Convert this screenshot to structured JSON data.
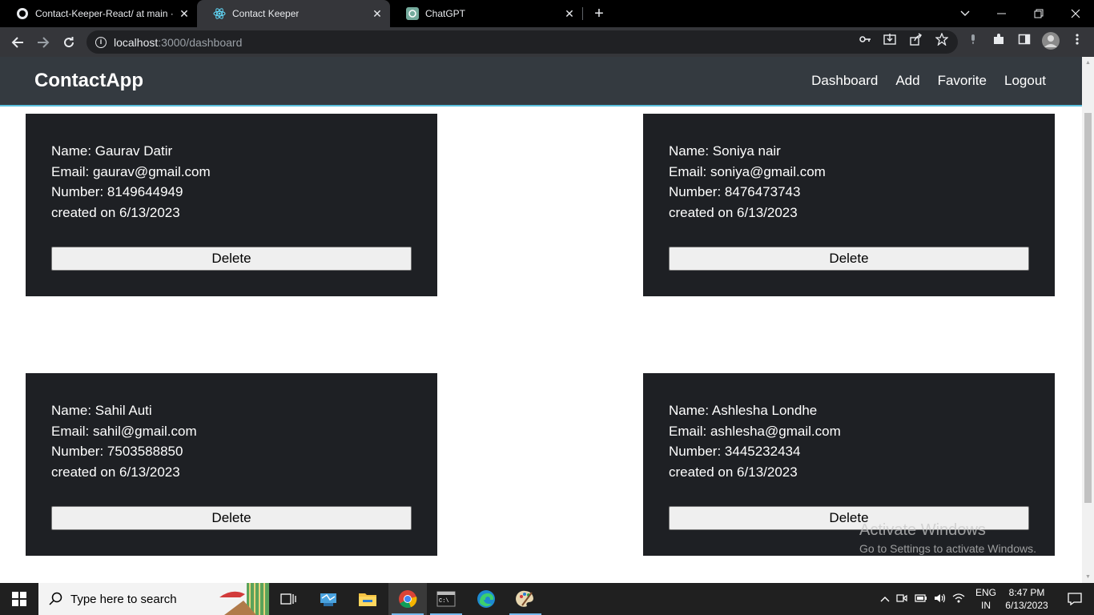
{
  "browser": {
    "tabs": [
      {
        "title": "Contact-Keeper-React/ at main ·",
        "icon": "github-icon"
      },
      {
        "title": "Contact Keeper",
        "icon": "react-icon"
      },
      {
        "title": "ChatGPT",
        "icon": "chatgpt-icon"
      }
    ],
    "active_tab": 1,
    "url_host": "localhost",
    "url_rest": ":3000/dashboard"
  },
  "app": {
    "brand": "ContactApp",
    "nav": [
      "Dashboard",
      "Add",
      "Favorite",
      "Logout"
    ],
    "contacts": [
      {
        "name": "Name: Gaurav Datir",
        "email": "Email: gaurav@gmail.com",
        "number": "Number: 8149644949",
        "created": "created on 6/13/2023",
        "delete": "Delete"
      },
      {
        "name": "Name: Soniya nair",
        "email": "Email: soniya@gmail.com",
        "number": "Number: 8476473743",
        "created": "created on 6/13/2023",
        "delete": "Delete"
      },
      {
        "name": "Name: Sahil Auti",
        "email": "Email: sahil@gmail.com",
        "number": "Number: 7503588850",
        "created": "created on 6/13/2023",
        "delete": "Delete"
      },
      {
        "name": "Name: Ashlesha Londhe",
        "email": "Email: ashlesha@gmail.com",
        "number": "Number: 3445232434",
        "created": "created on 6/13/2023",
        "delete": "Delete"
      }
    ]
  },
  "watermark": {
    "line1": "Activate Windows",
    "line2": "Go to Settings to activate Windows."
  },
  "taskbar": {
    "search_placeholder": "Type here to search",
    "lang_top": "ENG",
    "lang_bottom": "IN",
    "time": "8:47 PM",
    "date": "6/13/2023"
  },
  "colors": {
    "navbar_bg": "#343a40",
    "card_bg": "#1e2024",
    "navbar_border": "#5bc0de"
  }
}
